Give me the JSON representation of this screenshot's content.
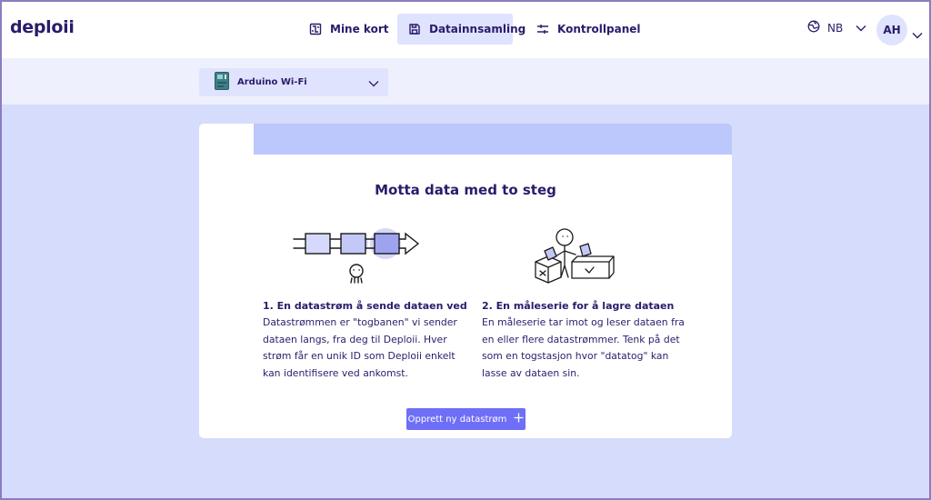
{
  "brand": {
    "logo": "deploii"
  },
  "nav": {
    "items": [
      {
        "label": "Mine kort",
        "icon": "circuit-board-icon"
      },
      {
        "label": "Datainnsamling",
        "icon": "database-icon",
        "active": true
      },
      {
        "label": "Kontrollpanel",
        "icon": "sliders-icon"
      }
    ]
  },
  "language": {
    "code": "NB",
    "icon": "globe-icon"
  },
  "user": {
    "initials": "AH"
  },
  "device_selector": {
    "value": "Arduino Wi-Fi",
    "icon": "device-board-icon"
  },
  "card": {
    "title": "Motta data med to steg",
    "steps": [
      {
        "title": "1. En datastrøm å sende dataen ved",
        "body_lines": [
          "Datastrømmen er \"togbanen\" vi sender",
          "dataen langs, fra deg til Deploii. Hver",
          "strøm får en unik ID som Deploii enkelt",
          "kan identifisere ved ankomst."
        ],
        "illustration": "data-stream-illustration"
      },
      {
        "title": "2. En måleserie for å lagre dataen",
        "body_lines": [
          "En måleserie tar imot og leser dataen fra",
          "en eller flere datastrømmer. Tenk på det",
          "som en togstasjon hvor \"datatog\" kan",
          "lasse av dataen sin."
        ],
        "illustration": "measurement-series-illustration"
      }
    ],
    "cta": {
      "label": "Opprett ny datastrøm",
      "icon": "plus-icon"
    }
  },
  "colors": {
    "primary_text": "#2b1b6b",
    "accent": "#6e6ff6",
    "page_background": "#d6dcfb",
    "nav_active": "#dfe3fd",
    "card_band": "#bcc7fb"
  }
}
